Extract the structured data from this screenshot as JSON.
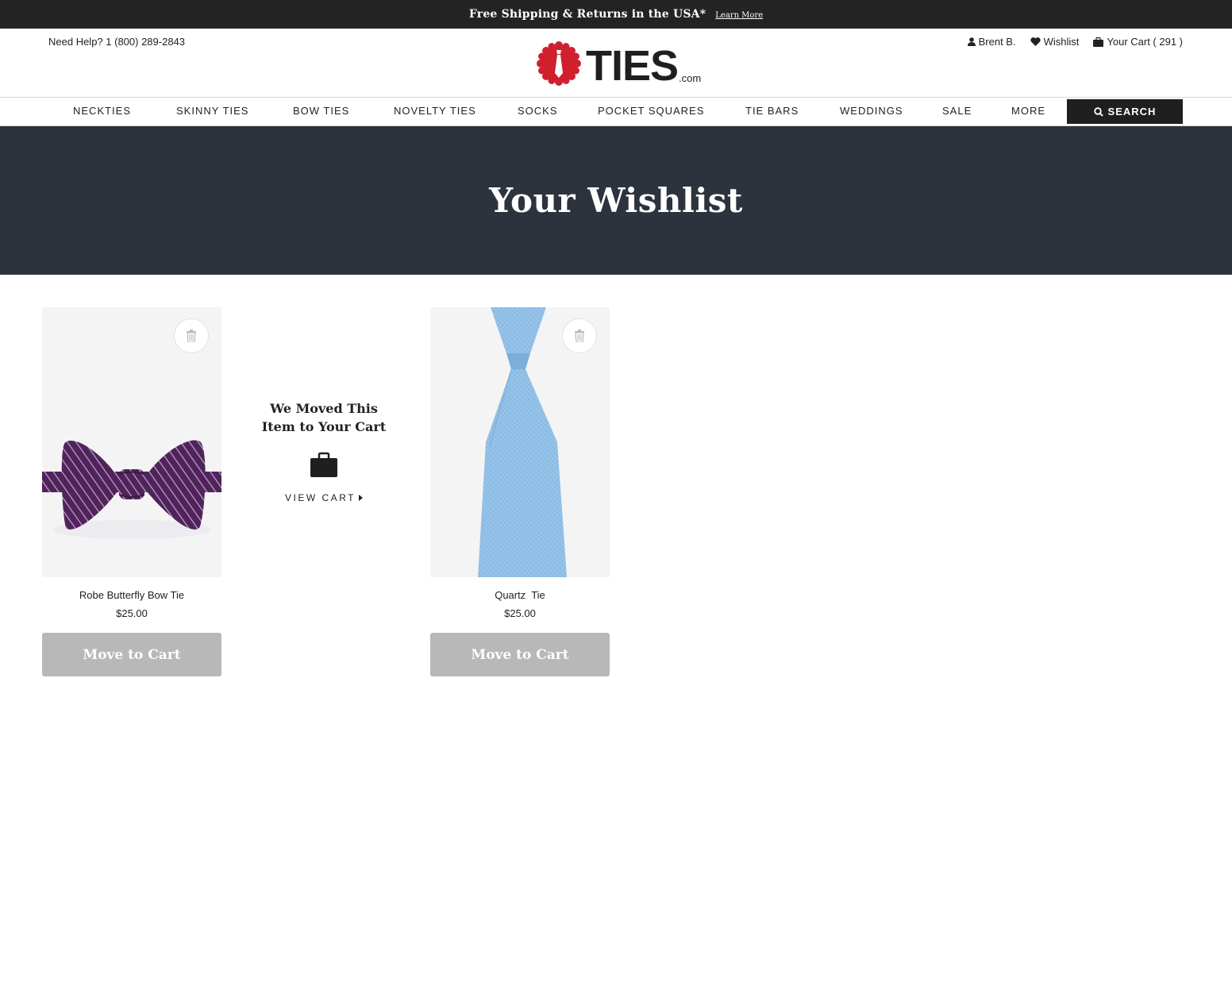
{
  "promo": {
    "text": "Free Shipping & Returns in the USA*",
    "link": "Learn More"
  },
  "header": {
    "help": "Need Help? 1 (800) 289-2843",
    "logo_word": "TIES",
    "logo_suffix": ".com",
    "user_name": "Brent B.",
    "wishlist_label": "Wishlist",
    "cart_label": "Your Cart ( 291 )"
  },
  "nav": {
    "items": [
      "NECKTIES",
      "SKINNY TIES",
      "BOW TIES",
      "NOVELTY TIES",
      "SOCKS",
      "POCKET SQUARES",
      "TIE BARS",
      "WEDDINGS",
      "SALE",
      "MORE"
    ],
    "search_label": "SEARCH"
  },
  "hero": {
    "title": "Your Wishlist"
  },
  "products": [
    {
      "name": "Robe Butterfly Bow Tie",
      "price": "$25.00",
      "button": "Move to Cart",
      "image_icon": "purple-striped-bow-tie"
    },
    {
      "name": "Quartz  Tie",
      "price": "$25.00",
      "button": "Move to Cart",
      "image_icon": "light-blue-necktie"
    }
  ],
  "moved_notice": {
    "line1": "We Moved This",
    "line2": "Item to Your Cart",
    "link": "VIEW CART"
  },
  "colors": {
    "promo_bg": "#232323",
    "hero_bg": "#2d333d",
    "button_disabled": "#b8b8b8",
    "logo_red": "#d0202e",
    "bow_tie_purple": "#4f2458",
    "tie_blue": "#8fbee6"
  }
}
